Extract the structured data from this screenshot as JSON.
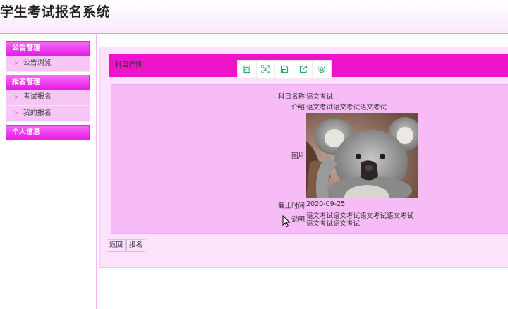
{
  "app": {
    "title": "学生考试报名系统"
  },
  "sidebar": {
    "groups": [
      {
        "title": "公告管理",
        "items": [
          "公告浏览"
        ]
      },
      {
        "title": "报名管理",
        "items": [
          "考试报名",
          "我的报名"
        ]
      },
      {
        "title": "个人信息",
        "items": []
      }
    ]
  },
  "panel": {
    "title": "科目详情",
    "toolbar": [
      "copy-icon",
      "fullscreen-icon",
      "save-icon",
      "export-icon",
      "settings-icon"
    ]
  },
  "detail": {
    "name_label": "科目名称",
    "name_value": "语文考试",
    "intro_label": "介绍",
    "intro_value": "语文考试语文考试语文考试",
    "image_label": "图片",
    "deadline_label": "截止时间",
    "deadline_value": "2020-09-25",
    "note_label": "说明",
    "note_line1": "语文考试语文考试语文考试语文考试",
    "note_line2": "语文考试语文考试"
  },
  "actions": {
    "back": "返回",
    "apply": "报名"
  },
  "colors": {
    "accent": "#ee12c8",
    "menu_head": "#e61ee6",
    "menu_item": "#f7c6f7",
    "content": "#f7bcf7"
  }
}
